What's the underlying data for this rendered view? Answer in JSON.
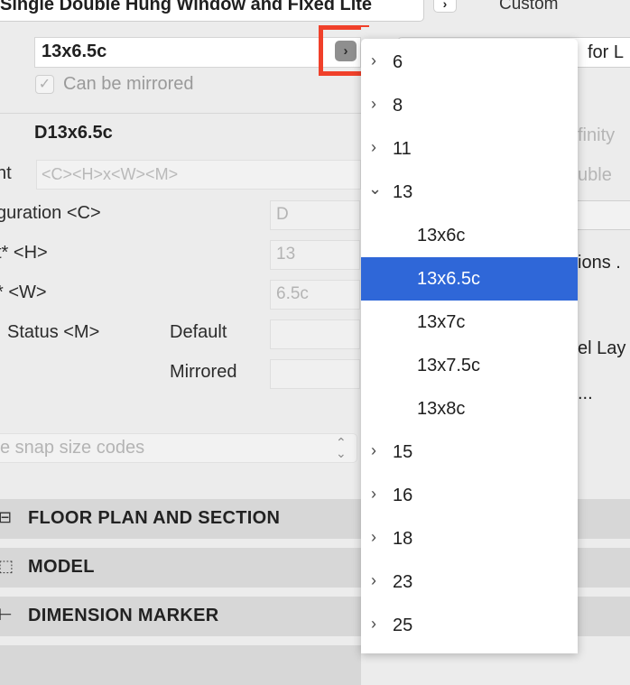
{
  "header": {
    "title": "Single Double Hung Window and Fixed Lite",
    "chevron_icon": "chevron-right-icon",
    "custom_label": "Custom"
  },
  "size_selector": {
    "value": "13x6.5c",
    "button_icon": "chevron-right-icon",
    "highlight_color": "#f0402a",
    "can_be_mirrored_label": "Can be mirrored",
    "can_be_mirrored_checked": true
  },
  "name_label": "D13x6.5c",
  "pattern": {
    "label": "nt",
    "placeholder": "<C><H>x<W><M>"
  },
  "fields": [
    {
      "label": "guration <C>",
      "value": "D"
    },
    {
      "label": "t* <H>",
      "value": "13"
    },
    {
      "label": "* <W>",
      "value": "6.5c"
    }
  ],
  "status": {
    "label": "Status <M>",
    "default_label": "Default",
    "mirrored_label": "Mirrored"
  },
  "snap_select": {
    "text": "e snap size codes",
    "icon": "updown-arrows-icon"
  },
  "sections": [
    {
      "label": "FLOOR PLAN AND SECTION",
      "icon": "floor-plan-icon"
    },
    {
      "label": "MODEL",
      "icon": "model-icon"
    },
    {
      "label": "DIMENSION MARKER",
      "icon": "dimension-marker-icon"
    }
  ],
  "right_panel": {
    "top_field_text": "for L",
    "infinity_text": "finity",
    "double_text": "uble",
    "options_text": "ions .",
    "layer_text": "el Lay",
    "ellipsis_text": "..."
  },
  "dropdown": {
    "selected_color": "#2f67d8",
    "items": [
      {
        "label": "6",
        "type": "group",
        "expanded": false
      },
      {
        "label": "8",
        "type": "group",
        "expanded": false
      },
      {
        "label": "11",
        "type": "group",
        "expanded": false
      },
      {
        "label": "13",
        "type": "group",
        "expanded": true
      },
      {
        "label": "13x6c",
        "type": "leaf",
        "selected": false
      },
      {
        "label": "13x6.5c",
        "type": "leaf",
        "selected": true
      },
      {
        "label": "13x7c",
        "type": "leaf",
        "selected": false
      },
      {
        "label": "13x7.5c",
        "type": "leaf",
        "selected": false
      },
      {
        "label": "13x8c",
        "type": "leaf",
        "selected": false
      },
      {
        "label": "15",
        "type": "group",
        "expanded": false
      },
      {
        "label": "16",
        "type": "group",
        "expanded": false
      },
      {
        "label": "18",
        "type": "group",
        "expanded": false
      },
      {
        "label": "23",
        "type": "group",
        "expanded": false
      },
      {
        "label": "25",
        "type": "group",
        "expanded": false
      }
    ]
  }
}
